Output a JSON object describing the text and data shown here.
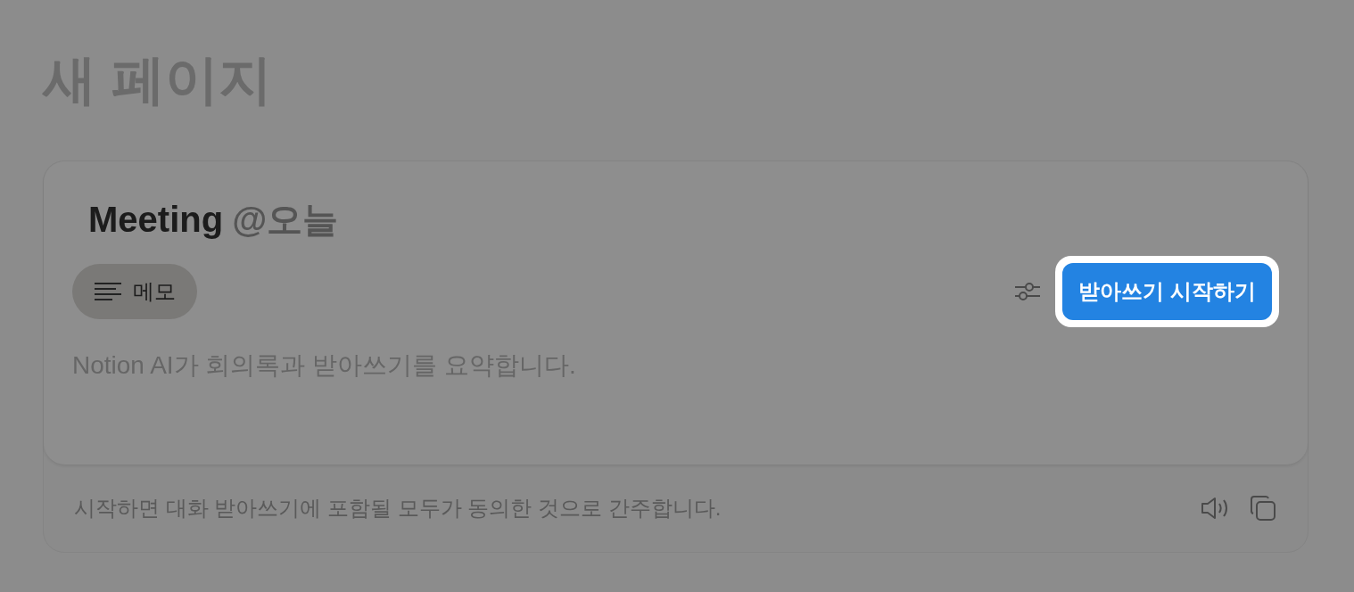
{
  "page_title": "새 페이지",
  "meeting": {
    "title": "Meeting",
    "date": "@오늘",
    "tabs": [
      {
        "label": "메모",
        "selected": true
      }
    ],
    "start_button": {
      "label": "받아쓰기 시작하기",
      "highlighted": true
    },
    "description": "Notion AI가 회의록과 받아쓰기를 요약합니다.",
    "footer": "시작하면 대화 받아쓰기에 포함될 모두가 동의한 것으로 간주합니다."
  }
}
